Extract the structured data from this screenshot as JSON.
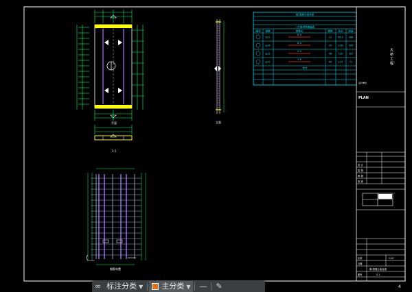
{
  "drawing": {
    "page_number": "4",
    "table": {
      "title": "钢-混凝土组合梁",
      "subtitle": "一片梁材料数量表",
      "header": [
        "编号",
        "规格",
        "单根长",
        "根数",
        "总长",
        "质量"
      ],
      "rows": [
        [
          "①",
          "φ22",
          "8.0",
          "12",
          "96.0",
          "286"
        ],
        [
          "②",
          "φ16",
          "6.3",
          "20",
          "126",
          "199"
        ],
        [
          "③",
          "φ12",
          "2.5",
          "48",
          "120",
          "107"
        ],
        [
          "④",
          "φ10",
          "1.8",
          "64",
          "115",
          "71"
        ]
      ],
      "footer_title": "合计"
    },
    "title_block": {
      "project": "大 桥 工 程",
      "company": "设计单位",
      "label_a": "PLAN",
      "sign_labels": [
        "设 计",
        "复 核",
        "审 核",
        "批 准"
      ],
      "drawing_name": "钢-混凝土组合梁",
      "scale_label": "比例",
      "scale_value": "1:20",
      "date_label": "日期",
      "sheet_label": "图号",
      "sheet_value": "S-1"
    },
    "view_labels": {
      "plan": "平面",
      "elevation": "立面",
      "section": "1-1",
      "rebar": "钢筋布置"
    }
  },
  "toolbar": {
    "item1_label": "标注分类",
    "item2_label": "主分类",
    "accent": "#e0701c"
  },
  "colors": {
    "background": "#000000",
    "frame": "#ffffff",
    "table": "#00e5ff",
    "beam": "#ffff00",
    "rebar": "#b070ff",
    "dimension": "#00ff66"
  }
}
